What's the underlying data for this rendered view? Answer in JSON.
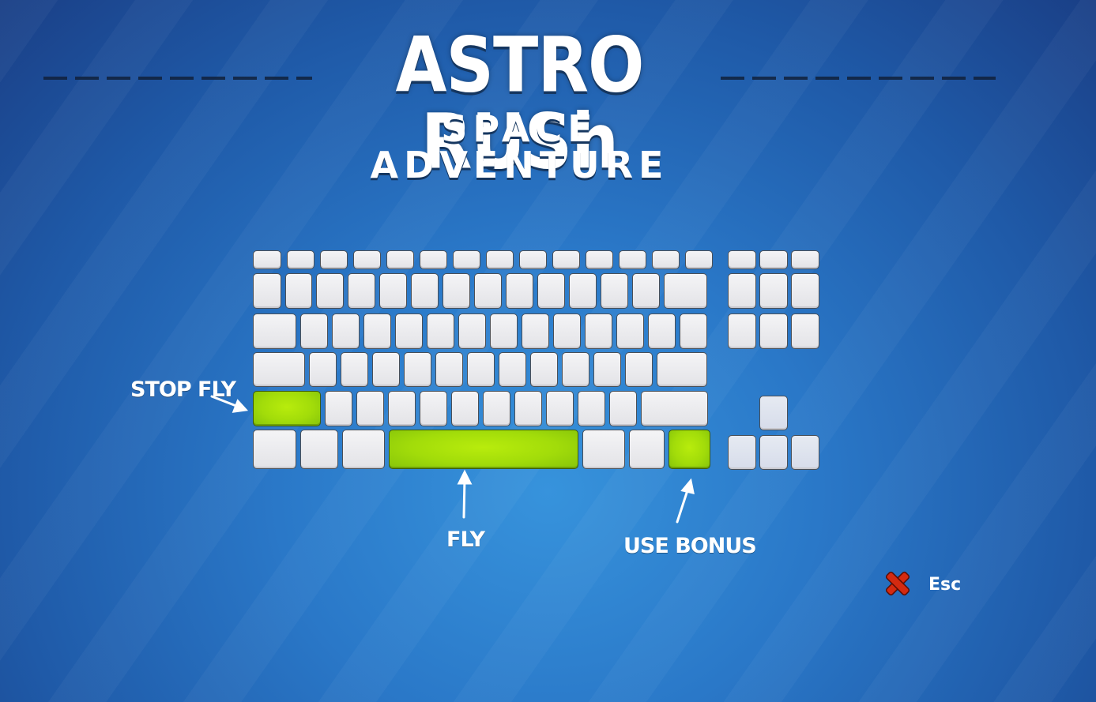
{
  "title": {
    "main": "ASTRO RUSh",
    "subtitle": "SPACE ADVENTURE"
  },
  "controls": {
    "stop_fly": "STOP FLY",
    "fly": "FLY",
    "use_bonus": "USE BONUS"
  },
  "escape": {
    "label": "Esc",
    "icon": "close-x-icon"
  },
  "colors": {
    "highlight_key": "#a6e00a",
    "key": "#ececef",
    "background": "#2a78c8",
    "close_icon": "#d42a10"
  }
}
